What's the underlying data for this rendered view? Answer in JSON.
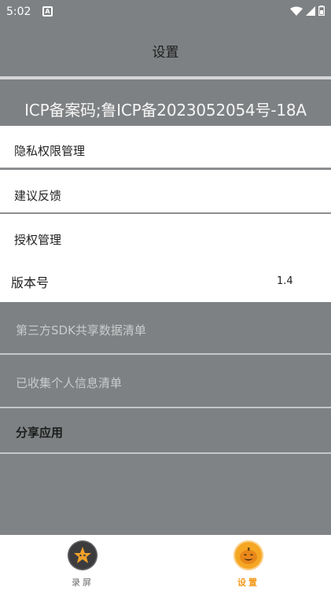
{
  "status_bar": {
    "time": "5:02",
    "notification_icon": "A"
  },
  "header": {
    "title": "设置"
  },
  "icp": {
    "text": "ICP备案码;鲁ICP备2023052054号-18A"
  },
  "menu": {
    "privacy": "隐私权限管理",
    "feedback": "建议反馈",
    "authorization": "授权管理",
    "version_label": "版本号",
    "version_value": "1.4",
    "sdk_list": "第三方SDK共享数据清单",
    "personal_info": "已收集个人信息清单",
    "share_app": "分享应用"
  },
  "tabs": [
    {
      "label": "录屏",
      "icon": "star-icon",
      "active": false
    },
    {
      "label": "设置",
      "icon": "pumpkin-icon",
      "active": true
    }
  ],
  "colors": {
    "accent": "#f39a1f",
    "dim": "#808385",
    "tab_active": "#f39a1f"
  }
}
